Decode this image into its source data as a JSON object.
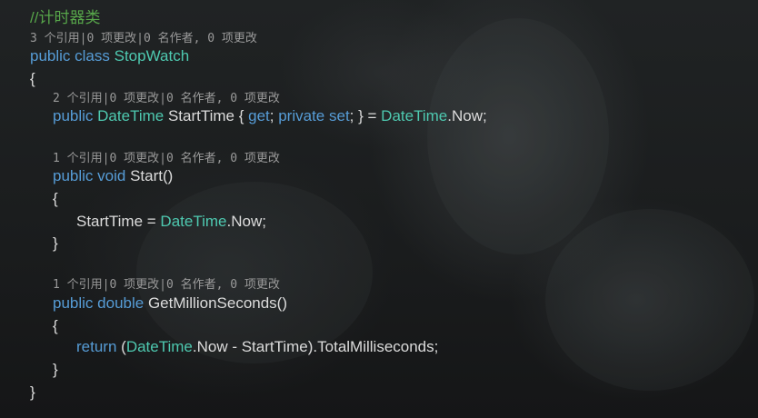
{
  "comment": "//计时器类",
  "codelens": {
    "class": "3 个引用|0 项更改|0 名作者, 0 项更改",
    "property": "2 个引用|0 项更改|0 名作者, 0 项更改",
    "start": "1 个引用|0 项更改|0 名作者, 0 项更改",
    "method": "1 个引用|0 项更改|0 名作者, 0 项更改"
  },
  "code": {
    "class_line": {
      "k1": "public",
      "k2": "class",
      "name": "StopWatch"
    },
    "brace_open": "{",
    "brace_close": "}",
    "prop_line": {
      "k1": "public",
      "type": "DateTime",
      "name": " StartTime { ",
      "get": "get",
      "sep": "; ",
      "k2": "private",
      "set": "set",
      "rest": "; } = ",
      "type2": "DateTime",
      "tail": ".Now;"
    },
    "start_line": {
      "k1": "public",
      "k2": "void",
      "name": " Start()"
    },
    "start_body": {
      "name": "StartTime = ",
      "type": "DateTime",
      "tail": ".Now;"
    },
    "method_line": {
      "k1": "public",
      "k2": "double",
      "name": " GetMillionSeconds()"
    },
    "return_line": {
      "k1": "return",
      "open": " (",
      "type": "DateTime",
      "tail": ".Now - StartTime).TotalMilliseconds;"
    }
  },
  "colors": {
    "keyword": "#569cd6",
    "type": "#4ec9b0",
    "comment": "#57a64a",
    "text": "#dcdcdc",
    "codelens": "#9a9a9a"
  }
}
